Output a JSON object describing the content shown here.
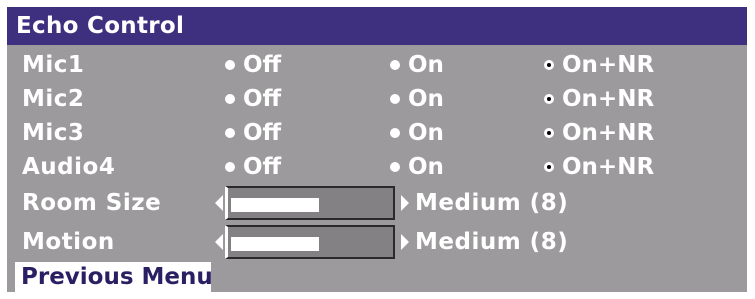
{
  "window": {
    "title": "Echo Control"
  },
  "channels": [
    {
      "label": "Mic1",
      "options": [
        "Off",
        "On",
        "On+NR"
      ],
      "selected": "On+NR"
    },
    {
      "label": "Mic2",
      "options": [
        "Off",
        "On",
        "On+NR"
      ],
      "selected": "On+NR"
    },
    {
      "label": "Mic3",
      "options": [
        "Off",
        "On",
        "On+NR"
      ],
      "selected": "On+NR"
    },
    {
      "label": "Audio4",
      "options": [
        "Off",
        "On",
        "On+NR"
      ],
      "selected": "On+NR"
    }
  ],
  "sliders": [
    {
      "label": "Room Size",
      "value_text": "Medium (8)",
      "fill_fraction": 0.55
    },
    {
      "label": "Motion",
      "value_text": "Medium (8)",
      "fill_fraction": 0.55
    }
  ],
  "footer": {
    "previous_menu_label": "Previous Menu"
  },
  "colors": {
    "title_bg": "#3e2f7f",
    "panel_bg": "#9c9a9c",
    "text": "#ffffff"
  }
}
